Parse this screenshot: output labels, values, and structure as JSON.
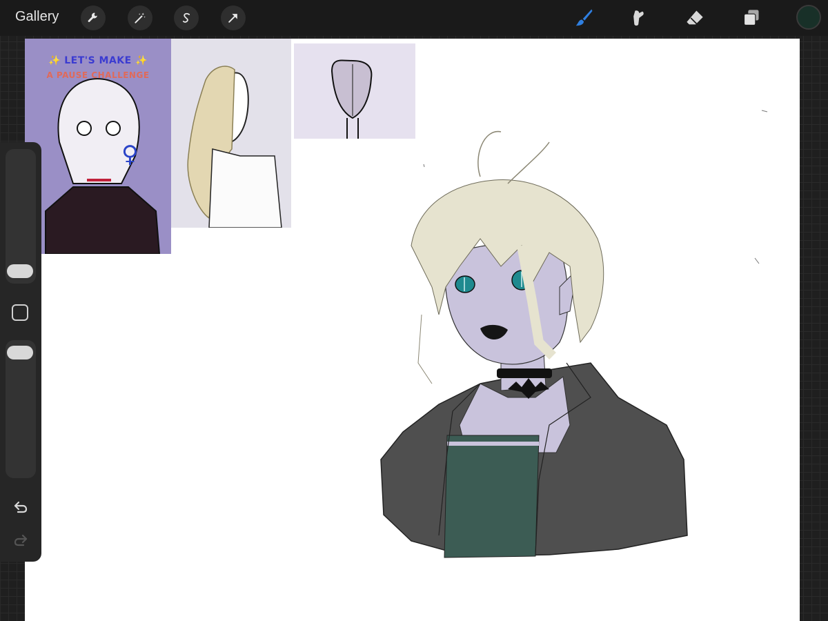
{
  "toolbar": {
    "gallery_label": "Gallery",
    "left_tools": [
      "wrench-icon",
      "magic-wand-icon",
      "selection-icon",
      "transform-arrow-icon"
    ],
    "right_tools": [
      "brush-icon",
      "smudge-icon",
      "eraser-icon",
      "layers-icon"
    ],
    "active_tool": "brush",
    "accent_color": "#2f7fe0",
    "current_color": "#183028"
  },
  "references": {
    "ref1_line1": "✨ LET'S MAKE ✨",
    "ref1_line2": "A PAUSE CHALLENGE",
    "ref1_female_symbol": "♀"
  },
  "sidebar": {
    "size_slider_level": 0.85,
    "opacity_slider_level": 0.05
  },
  "palette": {
    "skin": "#c9c3dc",
    "hair": "#e6e3cf",
    "eyes": "#1f8a8f",
    "jacket": "#4f4f4f",
    "top": "#3c5c54"
  }
}
